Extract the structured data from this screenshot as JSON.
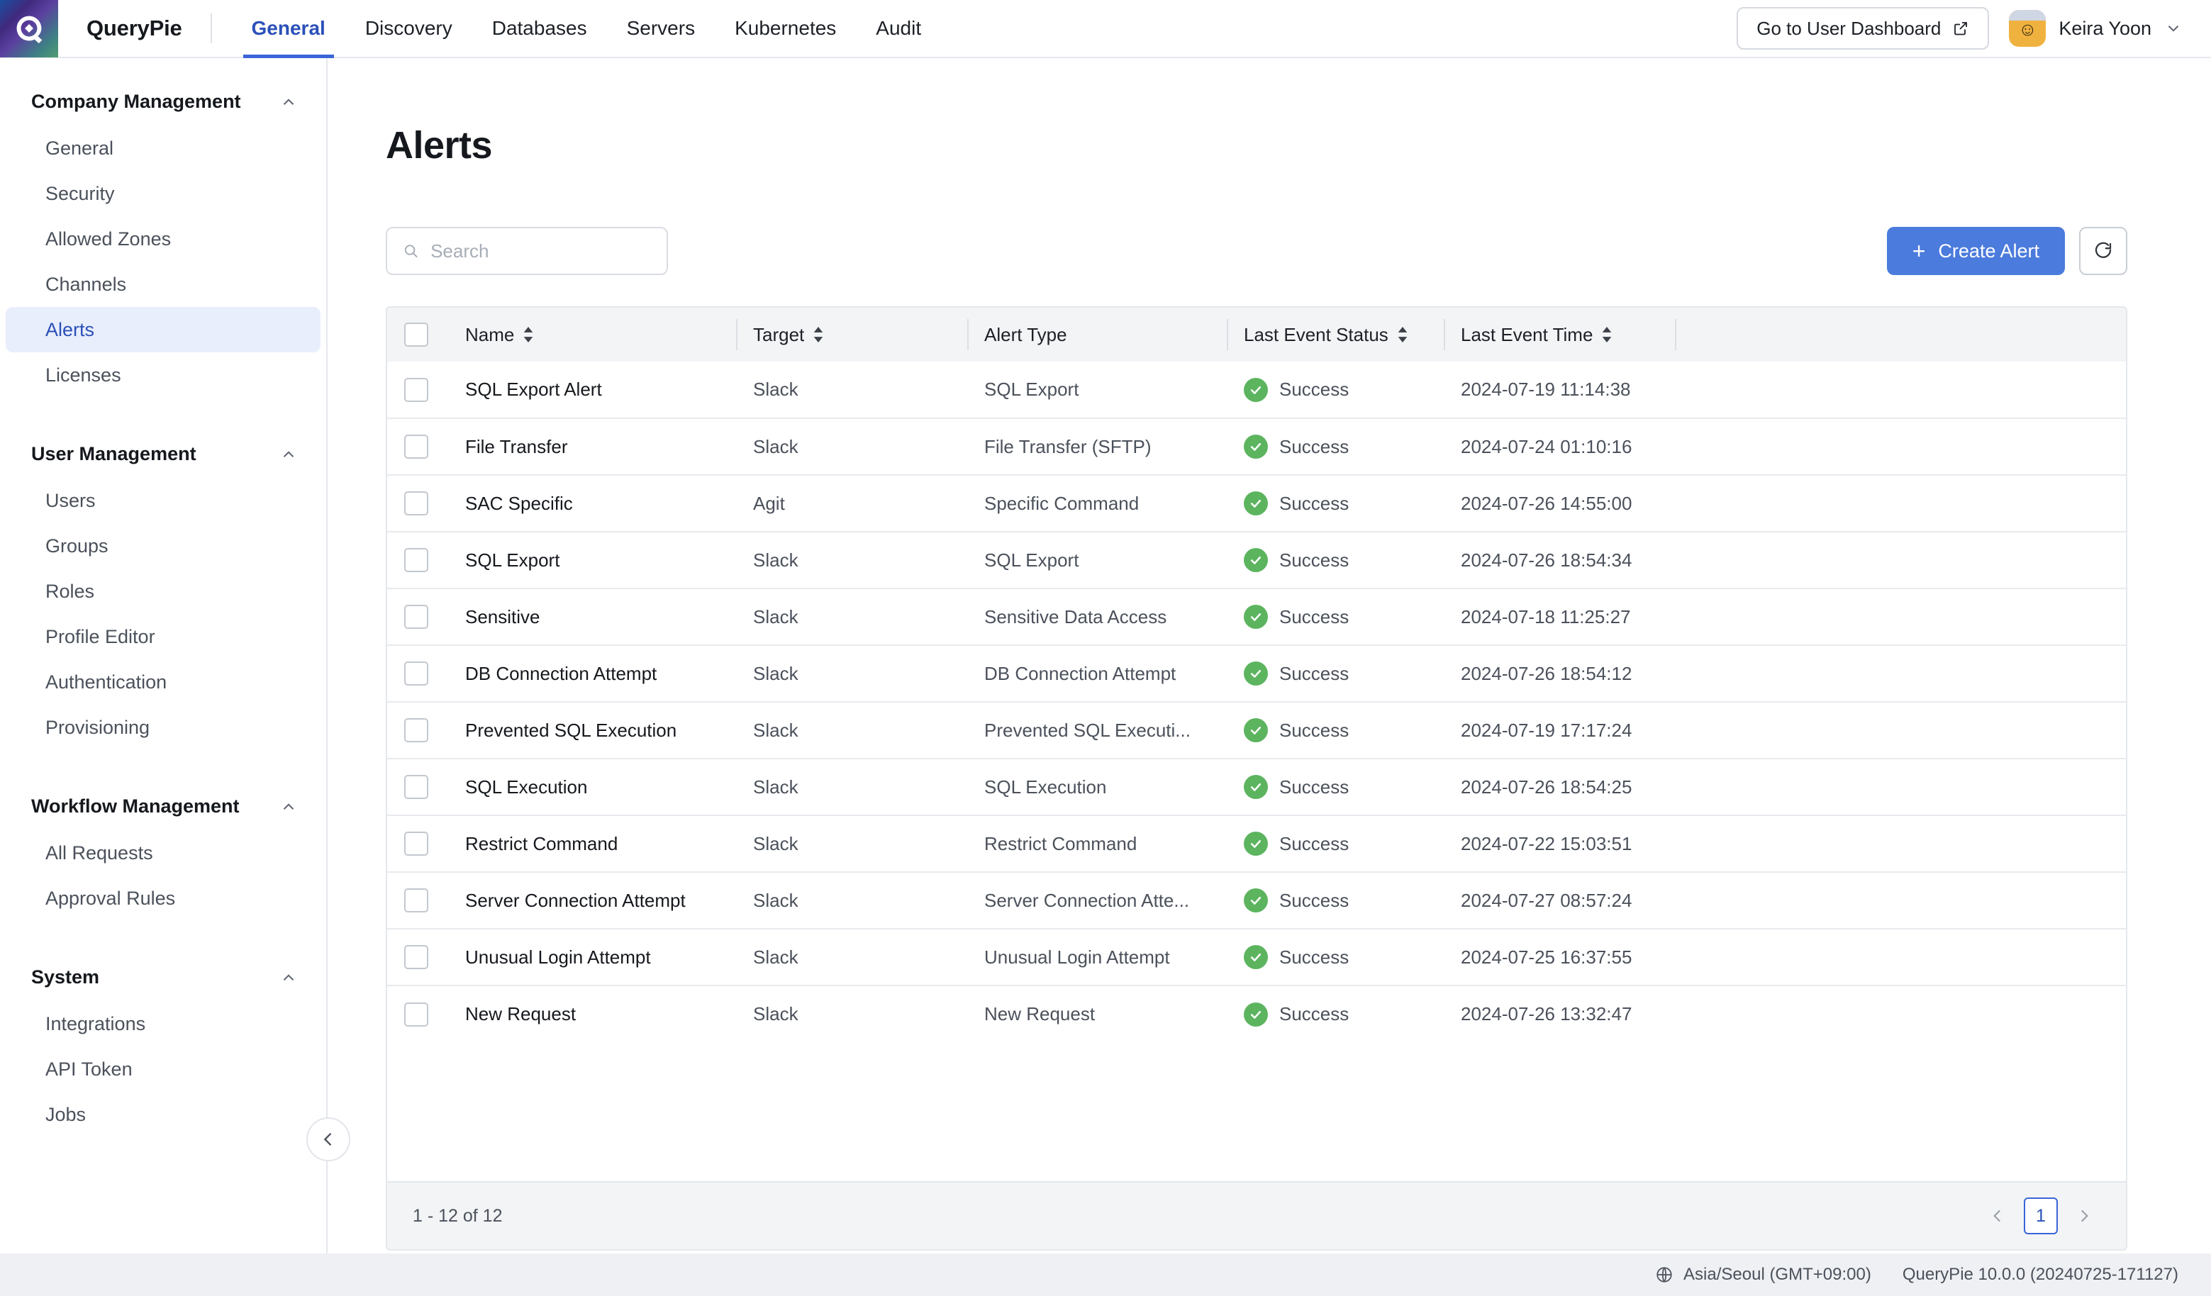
{
  "header": {
    "brand": "QueryPie",
    "logo_icon": "querypie-logo-icon",
    "nav": [
      {
        "label": "General",
        "active": true
      },
      {
        "label": "Discovery",
        "active": false
      },
      {
        "label": "Databases",
        "active": false
      },
      {
        "label": "Servers",
        "active": false
      },
      {
        "label": "Kubernetes",
        "active": false
      },
      {
        "label": "Audit",
        "active": false
      }
    ],
    "dashboard_button": "Go to User Dashboard",
    "dashboard_icon": "external-link-icon",
    "user_name": "Keira Yoon",
    "user_avatar_face": "☺",
    "user_chevron_icon": "chevron-down-icon"
  },
  "sidebar": {
    "collapse_icon": "chevron-left-icon",
    "groups": [
      {
        "title": "Company Management",
        "collapse_icon": "chevron-up-icon",
        "items": [
          {
            "label": "General",
            "active": false
          },
          {
            "label": "Security",
            "active": false
          },
          {
            "label": "Allowed Zones",
            "active": false
          },
          {
            "label": "Channels",
            "active": false
          },
          {
            "label": "Alerts",
            "active": true
          },
          {
            "label": "Licenses",
            "active": false
          }
        ]
      },
      {
        "title": "User Management",
        "collapse_icon": "chevron-up-icon",
        "items": [
          {
            "label": "Users",
            "active": false
          },
          {
            "label": "Groups",
            "active": false
          },
          {
            "label": "Roles",
            "active": false
          },
          {
            "label": "Profile Editor",
            "active": false
          },
          {
            "label": "Authentication",
            "active": false
          },
          {
            "label": "Provisioning",
            "active": false
          }
        ]
      },
      {
        "title": "Workflow Management",
        "collapse_icon": "chevron-up-icon",
        "items": [
          {
            "label": "All Requests",
            "active": false
          },
          {
            "label": "Approval Rules",
            "active": false
          }
        ]
      },
      {
        "title": "System",
        "collapse_icon": "chevron-up-icon",
        "items": [
          {
            "label": "Integrations",
            "active": false
          },
          {
            "label": "API Token",
            "active": false
          },
          {
            "label": "Jobs",
            "active": false
          }
        ]
      }
    ]
  },
  "main": {
    "page_title": "Alerts",
    "search": {
      "placeholder": "Search",
      "value": "",
      "icon": "search-icon"
    },
    "create_button": {
      "label": "Create Alert",
      "icon": "plus-icon"
    },
    "refresh_button": {
      "icon": "refresh-icon"
    },
    "table": {
      "select_all_checkbox": "checkbox-unchecked",
      "columns": [
        {
          "label": "Name",
          "sortable": true
        },
        {
          "label": "Target",
          "sortable": true
        },
        {
          "label": "Alert Type",
          "sortable": false
        },
        {
          "label": "Last Event Status",
          "sortable": true
        },
        {
          "label": "Last Event Time",
          "sortable": true
        }
      ],
      "sort_icon": "sort-arrows-icon",
      "status_icon": "check-circle-icon",
      "rows": [
        {
          "name": "SQL Export Alert",
          "target": "Slack",
          "alert_type": "SQL Export",
          "status": "Success",
          "time": "2024-07-19 11:14:38"
        },
        {
          "name": "File Transfer",
          "target": "Slack",
          "alert_type": "File Transfer (SFTP)",
          "status": "Success",
          "time": "2024-07-24 01:10:16"
        },
        {
          "name": "SAC Specific",
          "target": "Agit",
          "alert_type": "Specific Command",
          "status": "Success",
          "time": "2024-07-26 14:55:00"
        },
        {
          "name": "SQL Export",
          "target": "Slack",
          "alert_type": "SQL Export",
          "status": "Success",
          "time": "2024-07-26 18:54:34"
        },
        {
          "name": "Sensitive",
          "target": "Slack",
          "alert_type": "Sensitive Data Access",
          "status": "Success",
          "time": "2024-07-18 11:25:27"
        },
        {
          "name": "DB Connection Attempt",
          "target": "Slack",
          "alert_type": "DB Connection Attempt",
          "status": "Success",
          "time": "2024-07-26 18:54:12"
        },
        {
          "name": "Prevented SQL Execution",
          "target": "Slack",
          "alert_type": "Prevented SQL Executi...",
          "status": "Success",
          "time": "2024-07-19 17:17:24"
        },
        {
          "name": "SQL Execution",
          "target": "Slack",
          "alert_type": "SQL Execution",
          "status": "Success",
          "time": "2024-07-26 18:54:25"
        },
        {
          "name": "Restrict Command",
          "target": "Slack",
          "alert_type": "Restrict Command",
          "status": "Success",
          "time": "2024-07-22 15:03:51"
        },
        {
          "name": "Server Connection Attempt",
          "target": "Slack",
          "alert_type": "Server Connection Atte...",
          "status": "Success",
          "time": "2024-07-27 08:57:24"
        },
        {
          "name": "Unusual Login Attempt",
          "target": "Slack",
          "alert_type": "Unusual Login Attempt",
          "status": "Success",
          "time": "2024-07-25 16:37:55"
        },
        {
          "name": "New Request",
          "target": "Slack",
          "alert_type": "New Request",
          "status": "Success",
          "time": "2024-07-26 13:32:47"
        }
      ],
      "footer": {
        "count_text": "1 - 12 of 12",
        "prev_icon": "chevron-left-icon",
        "next_icon": "chevron-right-icon",
        "current_page": "1"
      }
    }
  },
  "statusbar": {
    "globe_icon": "globe-icon",
    "timezone": "Asia/Seoul (GMT+09:00)",
    "version": "QueryPie 10.0.0 (20240725-171127)"
  },
  "colors": {
    "accent_blue": "#3a65d8",
    "primary_button": "#4b7bdc",
    "active_nav": "#2b50b8",
    "success_green": "#5cb45f",
    "sidebar_active_bg": "#e8eefc"
  }
}
